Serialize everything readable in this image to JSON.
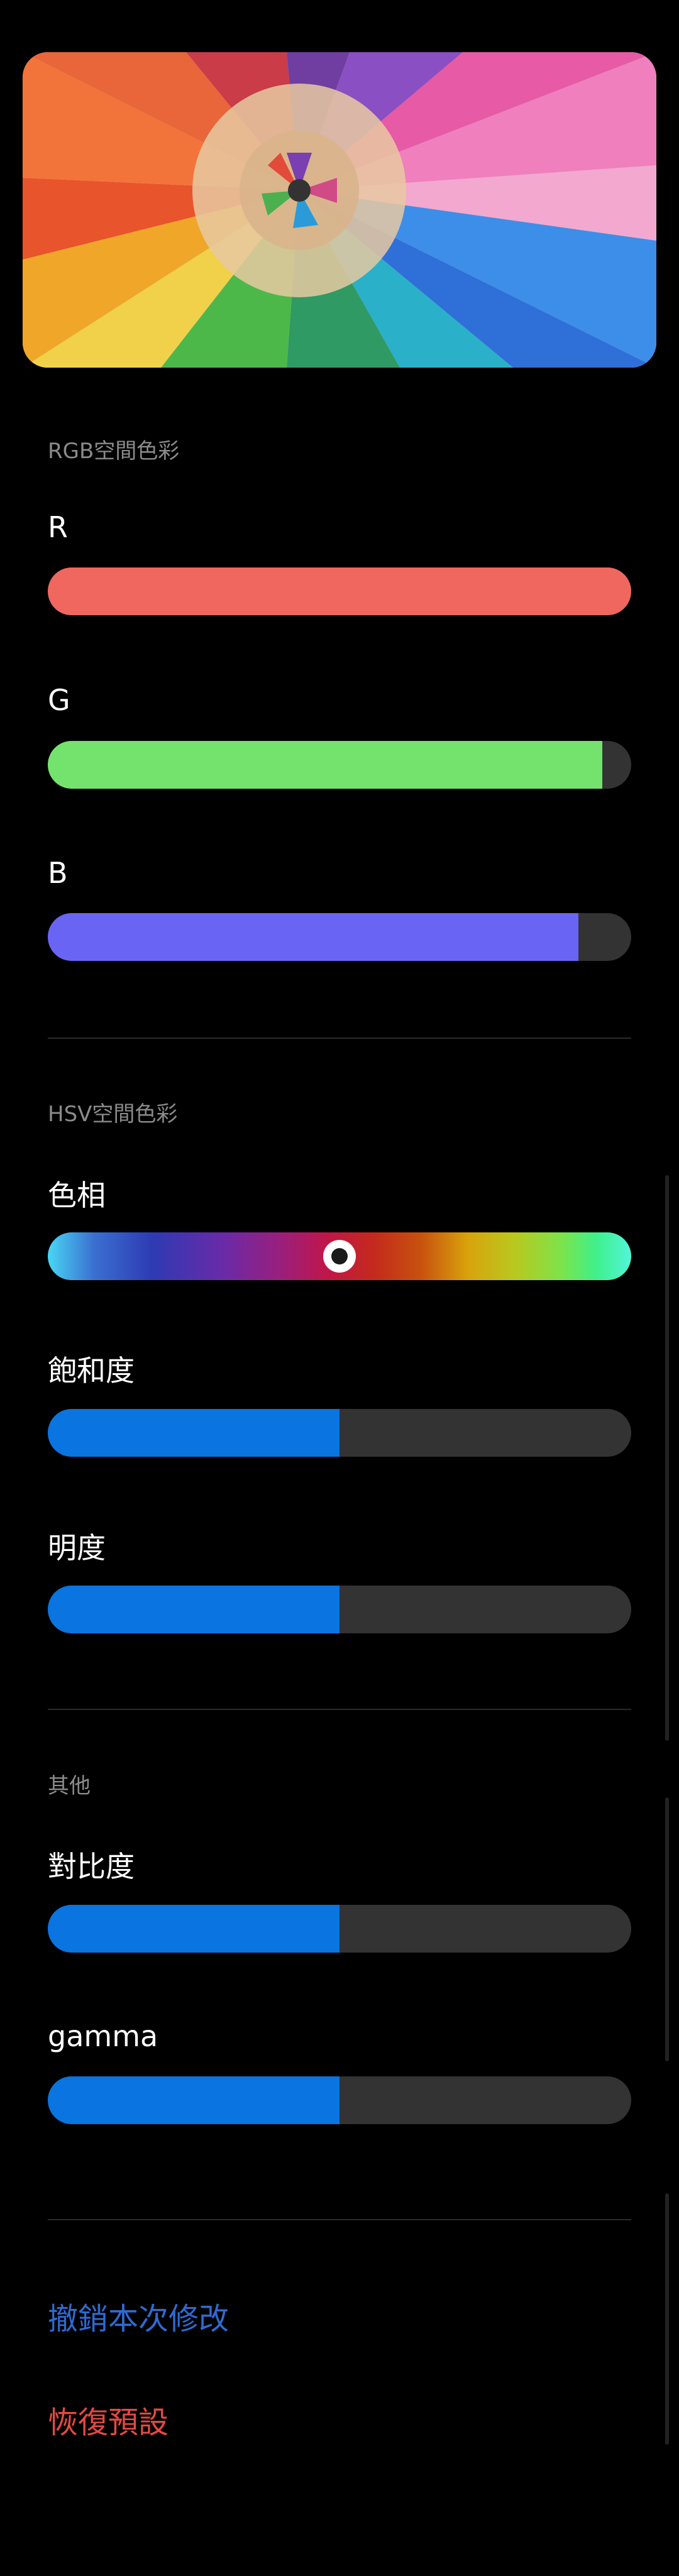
{
  "colors": {
    "r": "#f0675f",
    "g": "#74e36d",
    "b": "#6a64f5",
    "blue": "#0a74e0",
    "track": "#333333",
    "undo": "#2f6ad0",
    "reset": "#e24a43"
  },
  "preview": {
    "icon": "colored-pencils-image"
  },
  "rgb": {
    "section_title": "RGB空間色彩",
    "r": {
      "label": "R",
      "level": 1.0
    },
    "g": {
      "label": "G",
      "level": 0.95
    },
    "b": {
      "label": "B",
      "level": 0.91
    }
  },
  "hsv": {
    "section_title": "HSV空間色彩",
    "hue": {
      "label": "色相",
      "level": 0.5
    },
    "saturation": {
      "label": "飽和度",
      "level": 0.5
    },
    "brightness": {
      "label": "明度",
      "level": 0.5
    }
  },
  "other": {
    "section_title": "其他",
    "contrast": {
      "label": "對比度",
      "level": 0.5
    },
    "gamma": {
      "label": "gamma",
      "level": 0.5
    }
  },
  "actions": {
    "undo": "撤銷本次修改",
    "reset": "恢復預設"
  }
}
